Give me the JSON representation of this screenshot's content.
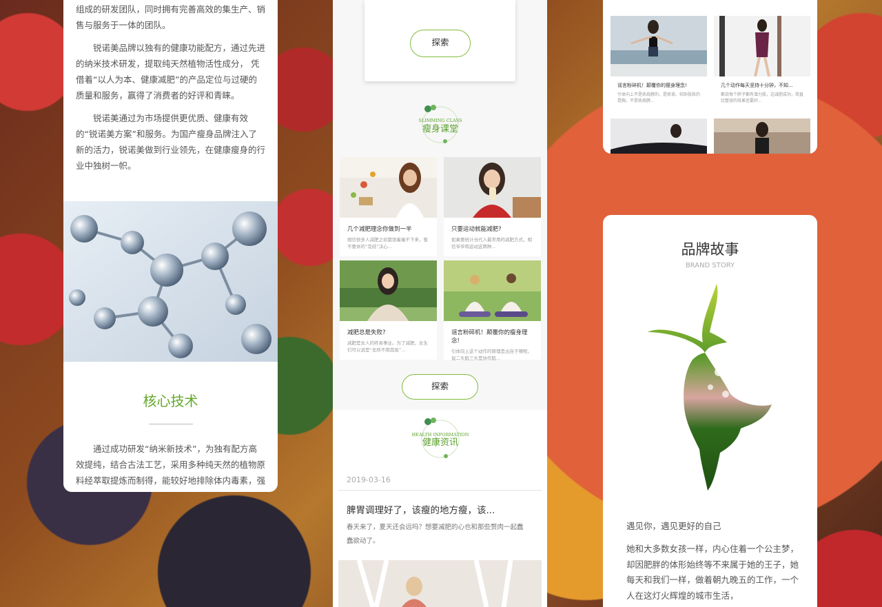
{
  "left": {
    "paragraphs": [
      "组成的研发团队，同时拥有完善高效的集生产、销售与服务于一体的团队。",
      "锐诺美品牌以独有的健康功能配方，通过先进的纳米技术研发，提取纯天然植物活性成分， 凭借着“以人为本、健康减肥”的产品定位与过硬的质量和服务，赢得了消费者的好评和青睐。",
      "锐诺美通过为市场提供更优质、健康有效的“锐诺美方案”和服务。为国产瘦身品牌注入了新的活力，锐诺美做到行业领先，在健康瘦身的行业中独树一帜。"
    ],
    "core_title": "核心技术",
    "core_text": "通过成功研发“纳米新技术”，为独有配方高效提纯，结合古法工艺，采用多种纯天然的植物原料经萃取提炼而制得，能较好地排除体内毒素，强化"
  },
  "middle": {
    "explore_top": "探索",
    "slimming": {
      "en": "SLIMMING CLASS",
      "cn": "瘦身课堂"
    },
    "grid": [
      {
        "title": "几个减肥理念你做到一半",
        "desc": "相信很多人减肥之初都饱着瘦不下来，暂不要休的“完结”决心..."
      },
      {
        "title": "只要运动就能减肥?",
        "desc": "如果要统计当代人最常用的减肥方式，相信爷爷和运动这两种..."
      },
      {
        "title": "减肥总是失败?",
        "desc": "减肥是女人的终身事业。为了减肥，女生们可以说是“无所不用其极”..."
      },
      {
        "title": "谣言粉碎机！颠覆你的瘦身理念!",
        "desc": "引体向上这个动作的原理是出自于哪呢。鼠二头肌三头是协作肌..."
      }
    ],
    "explore_bottom": "探索",
    "health": {
      "en": "HEALTH INFORMATION",
      "cn": "健康资讯"
    },
    "news": {
      "date": "2019-03-16",
      "title": "脾胃调理好了，该瘦的地方瘦，该...",
      "desc": "春天来了，夏天还会远吗？想要减肥的心也和那些赘肉一起蠢蠢欲动了。"
    }
  },
  "right_top": {
    "items": [
      {
        "title": "谣言粉碎机！颠覆你的瘦身理念!",
        "desc": "引体向上不是练肩膀的，是练背。较卧胶练的是胸，不是练肩膀..."
      },
      {
        "title": "几个动作每天坚持十分钟，不知...",
        "desc": "都说每个胖子都有潜力股，这减肥成功，简直比整容的效果还要好..."
      }
    ]
  },
  "brand_story": {
    "title": "品牌故事",
    "en": "BRAND STORY",
    "subtitle": "遇见你，遇见更好的自己",
    "paragraph": "她和大多数女孩一样，内心住着一个公主梦，却因肥胖的体形始终等不来属于她的王子，她每天和我们一样，做着朝九晚五的工作，一个人在这灯火辉煌的城市生活，"
  },
  "colors": {
    "accent": "#62a82a",
    "button_border": "#7fbd3c"
  }
}
